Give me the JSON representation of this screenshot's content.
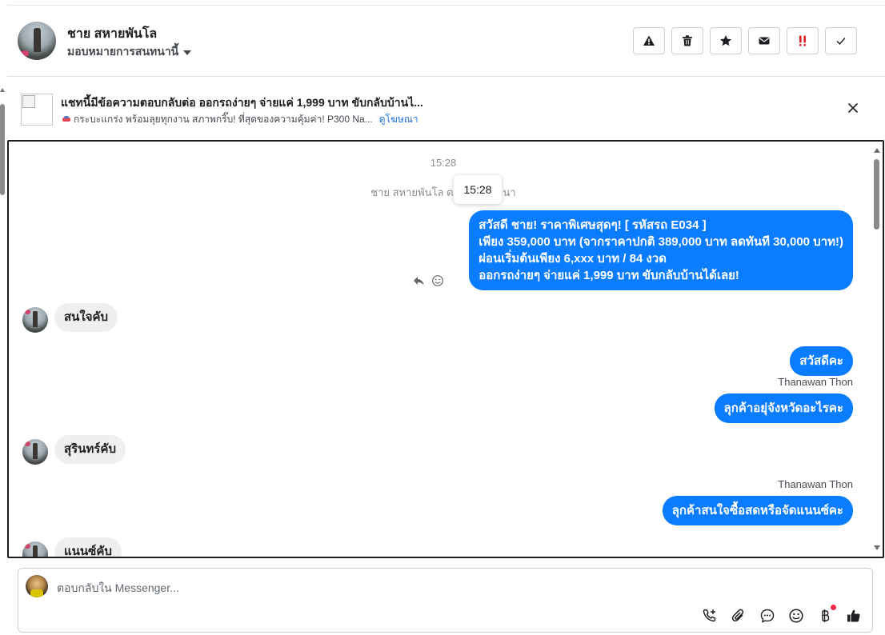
{
  "header": {
    "name": "ชาย สหายพันโล",
    "assign_label": "มอบหมายการสนทนานี้",
    "actions": [
      {
        "icon": "warning-icon",
        "label": "spam"
      },
      {
        "icon": "trash-icon",
        "label": "delete"
      },
      {
        "icon": "star-icon",
        "label": "star"
      },
      {
        "icon": "envelope-icon",
        "label": "unread"
      },
      {
        "icon": "exclamation-icon",
        "label": "follow-up"
      },
      {
        "icon": "checkmark-icon",
        "label": "done"
      }
    ]
  },
  "ad": {
    "title": "แชทนี้มีข้อความตอบกลับต่อ ออกรถง่ายๆ จ่ายแค่ 1,999 บาท ขับกลับบ้านไ...",
    "subtitle": "กระบะแกร่ง พร้อมลุยทุกงาน สภาพกริ๊บ! ที่สุดของความคุ้มค่า! P300 Na...",
    "link": "ดูโฆษณา"
  },
  "chat": {
    "timestamp": "15:28",
    "system_message": "ชาย สหายพันโล ตอบ",
    "system_message_tail": "นา",
    "tooltip": "15:28",
    "messages": {
      "out_1": {
        "lines": [
          "สวัสดี ชาย! ราคาพิเศษสุดๆ! [ รหัสรถ E034 ]",
          "เพียง 359,000 บาท (จากราคาปกติ 389,000 บาท ลดทันที 30,000 บาท!)",
          "ผ่อนเริ่มต้นเพียง 6,xxx บาท / 84 งวด",
          "ออกรถง่ายๆ จ่ายแค่ 1,999 บาท ขับกลับบ้านได้เลย!"
        ]
      },
      "in_1": "สนใจคับ",
      "out_2": "สวัสดีคะ",
      "sender_1": "Thanawan Thon",
      "out_3": "ลุกค้าอยุ่จังหวัดอะไรคะ",
      "in_2": "สุรินทร์คับ",
      "sender_2": "Thanawan Thon",
      "out_4": "ลุกค้าสนใจซื้อสดหรือจัดแนนซ์คะ",
      "in_3": "แนนซ์คับ"
    }
  },
  "composer": {
    "placeholder": "ตอบกลับใน Messenger...",
    "value": "",
    "tools": [
      "phone-plus-icon",
      "paperclip-icon",
      "saved-reply-icon",
      "emoji-icon",
      "baht-icon",
      "thumbs-up-icon"
    ]
  },
  "colors": {
    "outgoing_bubble": "#0a7cff",
    "incoming_bubble": "#efefef",
    "link": "#216fdb",
    "follow_up_icon": "#e02020"
  }
}
